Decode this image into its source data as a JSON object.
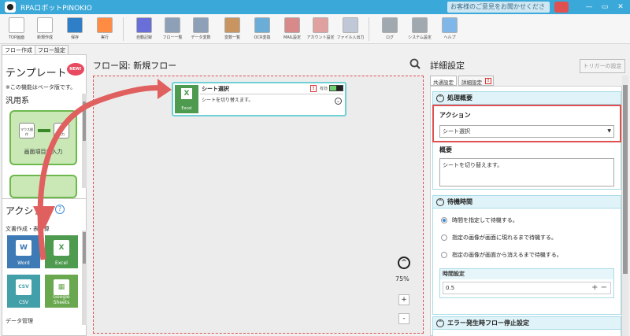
{
  "app": {
    "title": "RPAロボットPINOKIO"
  },
  "titlebar": {
    "feedback": "お客様のご意見をお聞かせください",
    "minimize": "—",
    "restore": "▭",
    "close": "✕"
  },
  "toolbar": {
    "items": [
      {
        "label": "TOP画面",
        "icon": "home-icon",
        "color": "#ffffff"
      },
      {
        "label": "新規作成",
        "icon": "new-file-icon",
        "color": "#ffffff"
      },
      {
        "label": "保存",
        "icon": "save-icon",
        "color": "#2e7ec8"
      },
      {
        "label": "実行",
        "icon": "play-icon",
        "color": "#ff8c42"
      },
      {
        "label": "自動記録",
        "icon": "record-icon",
        "color": "#6a6ed8"
      },
      {
        "label": "フロー一覧",
        "icon": "list-icon",
        "color": "#8ea0b8"
      },
      {
        "label": "データ変数",
        "icon": "database-icon",
        "color": "#8ea0b8"
      },
      {
        "label": "変数一覧",
        "icon": "box-icon",
        "color": "#c89560"
      },
      {
        "label": "OCR変換",
        "icon": "ocr-icon",
        "color": "#6aaed8"
      },
      {
        "label": "MAIL設定",
        "icon": "mail-icon",
        "color": "#d88a8a"
      },
      {
        "label": "アカウント設定",
        "icon": "account-icon",
        "color": "#e0a0a0"
      },
      {
        "label": "ファイル入出力",
        "icon": "download-icon",
        "color": "#c0c8d8"
      },
      {
        "label": "ログ",
        "icon": "log-icon",
        "color": "#a0a8b0"
      },
      {
        "label": "システム設定",
        "icon": "gear-icon",
        "color": "#a0a8b0"
      },
      {
        "label": "ヘルプ",
        "icon": "help-icon",
        "color": "#7fb8e8"
      }
    ]
  },
  "left_tabs": {
    "flow_create": "フロー作成",
    "flow_settings": "フロー設定"
  },
  "template": {
    "title": "テンプレート",
    "badge": "NEW!",
    "beta_note": "※この機能はベータ版です。",
    "category": "汎用系",
    "card1": {
      "label": "画面項目に入力",
      "box1": "マウス操作",
      "box2": "入力"
    }
  },
  "actions": {
    "title": "アクション",
    "help": "?",
    "category1": "文書作成・表計算",
    "tiles": [
      {
        "label": "Word",
        "glyph": "W",
        "color": "#3e7bb6"
      },
      {
        "label": "Excel",
        "glyph": "X",
        "color": "#4e9a4e"
      },
      {
        "label": "CSV",
        "glyph": "CSV",
        "color": "#44a0a8"
      },
      {
        "label": "Google Sheets",
        "glyph": "▦",
        "color": "#6aa84f"
      }
    ],
    "category2": "データ管理"
  },
  "flow": {
    "title": "フロー図: 新規フロー",
    "card": {
      "name": "シート選択",
      "desc": "シートを切り替えます。",
      "icon_glyph": "X",
      "icon_label": "Excel",
      "enabled": "有効",
      "warn": "!"
    },
    "zoom": "75%",
    "zoom_up": "^",
    "zoom_in": "+",
    "zoom_out": "-"
  },
  "details": {
    "title": "詳細設定",
    "trigger": "トリガーの設定",
    "tab_common": "共通設定",
    "tab_detail": "詳細設定",
    "tab_warn": "!",
    "overview": {
      "head": "処理概要",
      "action_label": "アクション",
      "action_value": "シート選択",
      "summary_label": "概要",
      "summary_value": "シートを切り替えます。"
    },
    "wait": {
      "head": "待機時間",
      "options": [
        "時間を指定して待機する。",
        "指定の画像が画面に現れるまで待機する。",
        "指定の画像が画面から消えるまで待機する。"
      ],
      "time_label": "時間設定",
      "time_value": "0.5",
      "plus_minus": "+ −"
    },
    "error": {
      "head": "エラー発生時フロー停止設定"
    }
  },
  "colors": {
    "titlebar": "#3aa8d8",
    "accent": "#e05050",
    "section": "#dff3f8"
  }
}
